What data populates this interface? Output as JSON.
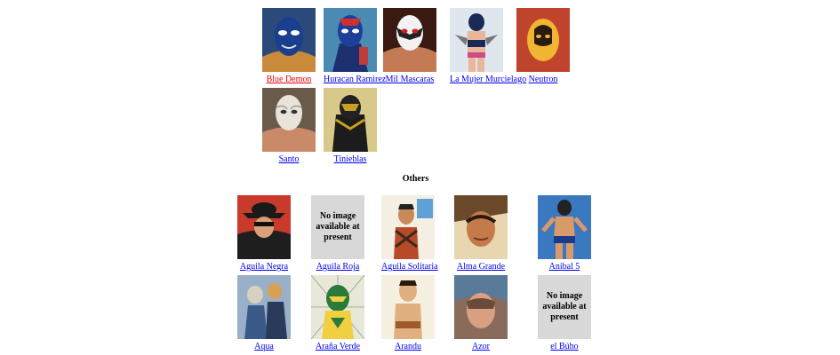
{
  "top_section": {
    "items": [
      {
        "label": "Blue Demon",
        "visited": true
      },
      {
        "label": "Huracan Ramirez"
      },
      {
        "label": "Mil Mascaras"
      },
      {
        "label": "La Mujer Murcielago"
      },
      {
        "label": "Neutron"
      },
      {
        "label": "Santo"
      },
      {
        "label": "Tinieblas"
      }
    ]
  },
  "others_section": {
    "heading": "Others",
    "no_image_text": "No image available at present",
    "items": [
      {
        "label": "Aguila Negra"
      },
      {
        "label": "Aguila Roja",
        "no_image": true
      },
      {
        "label": "Aguila Solitaria"
      },
      {
        "label": "Alma Grande"
      },
      {
        "label": "Anibal 5"
      },
      {
        "label": "Aqua"
      },
      {
        "label": "Araña Verde"
      },
      {
        "label": "Arandu"
      },
      {
        "label": "Azor"
      },
      {
        "label": "el Búho",
        "no_image": true
      }
    ]
  },
  "colors": {
    "link": "#0000ee",
    "visited_link": "#ee0000",
    "placeholder_bg": "#d8d8d8"
  }
}
